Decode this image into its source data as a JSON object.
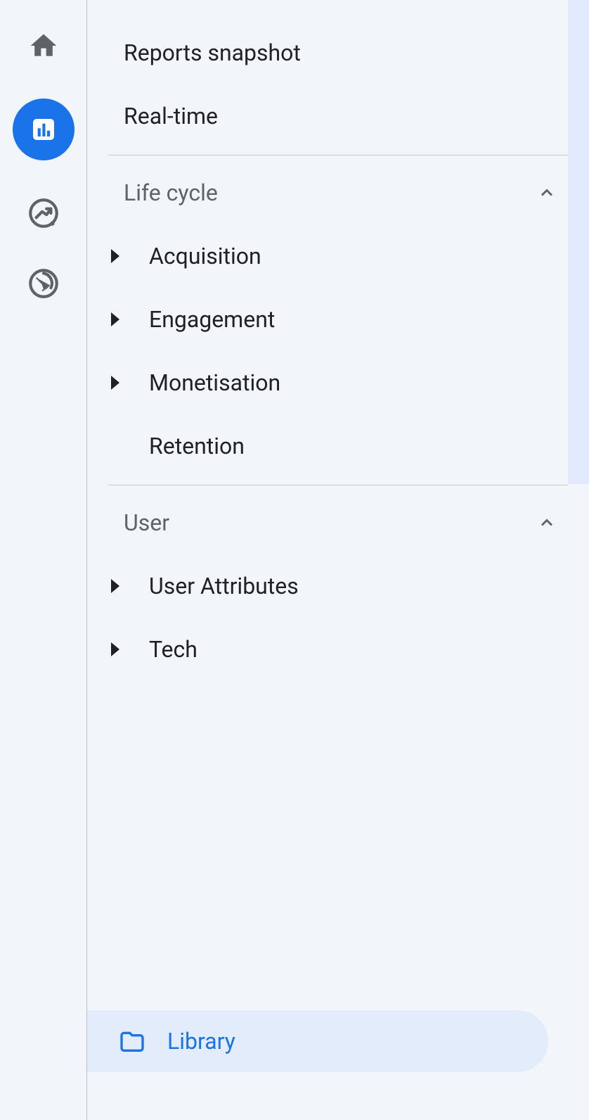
{
  "rail": {
    "icons": [
      {
        "name": "home-icon"
      },
      {
        "name": "reports-icon",
        "active": true
      },
      {
        "name": "explore-icon"
      },
      {
        "name": "advertising-icon"
      }
    ]
  },
  "nav": {
    "top_items": [
      {
        "label": "Reports snapshot"
      },
      {
        "label": "Real-time"
      }
    ],
    "sections": [
      {
        "label": "Life cycle",
        "items": [
          {
            "label": "Acquisition",
            "expandable": true
          },
          {
            "label": "Engagement",
            "expandable": true
          },
          {
            "label": "Monetisation",
            "expandable": true
          },
          {
            "label": "Retention",
            "expandable": false
          }
        ]
      },
      {
        "label": "User",
        "items": [
          {
            "label": "User Attributes",
            "expandable": true
          },
          {
            "label": "Tech",
            "expandable": true
          }
        ]
      }
    ]
  },
  "library": {
    "label": "Library"
  }
}
